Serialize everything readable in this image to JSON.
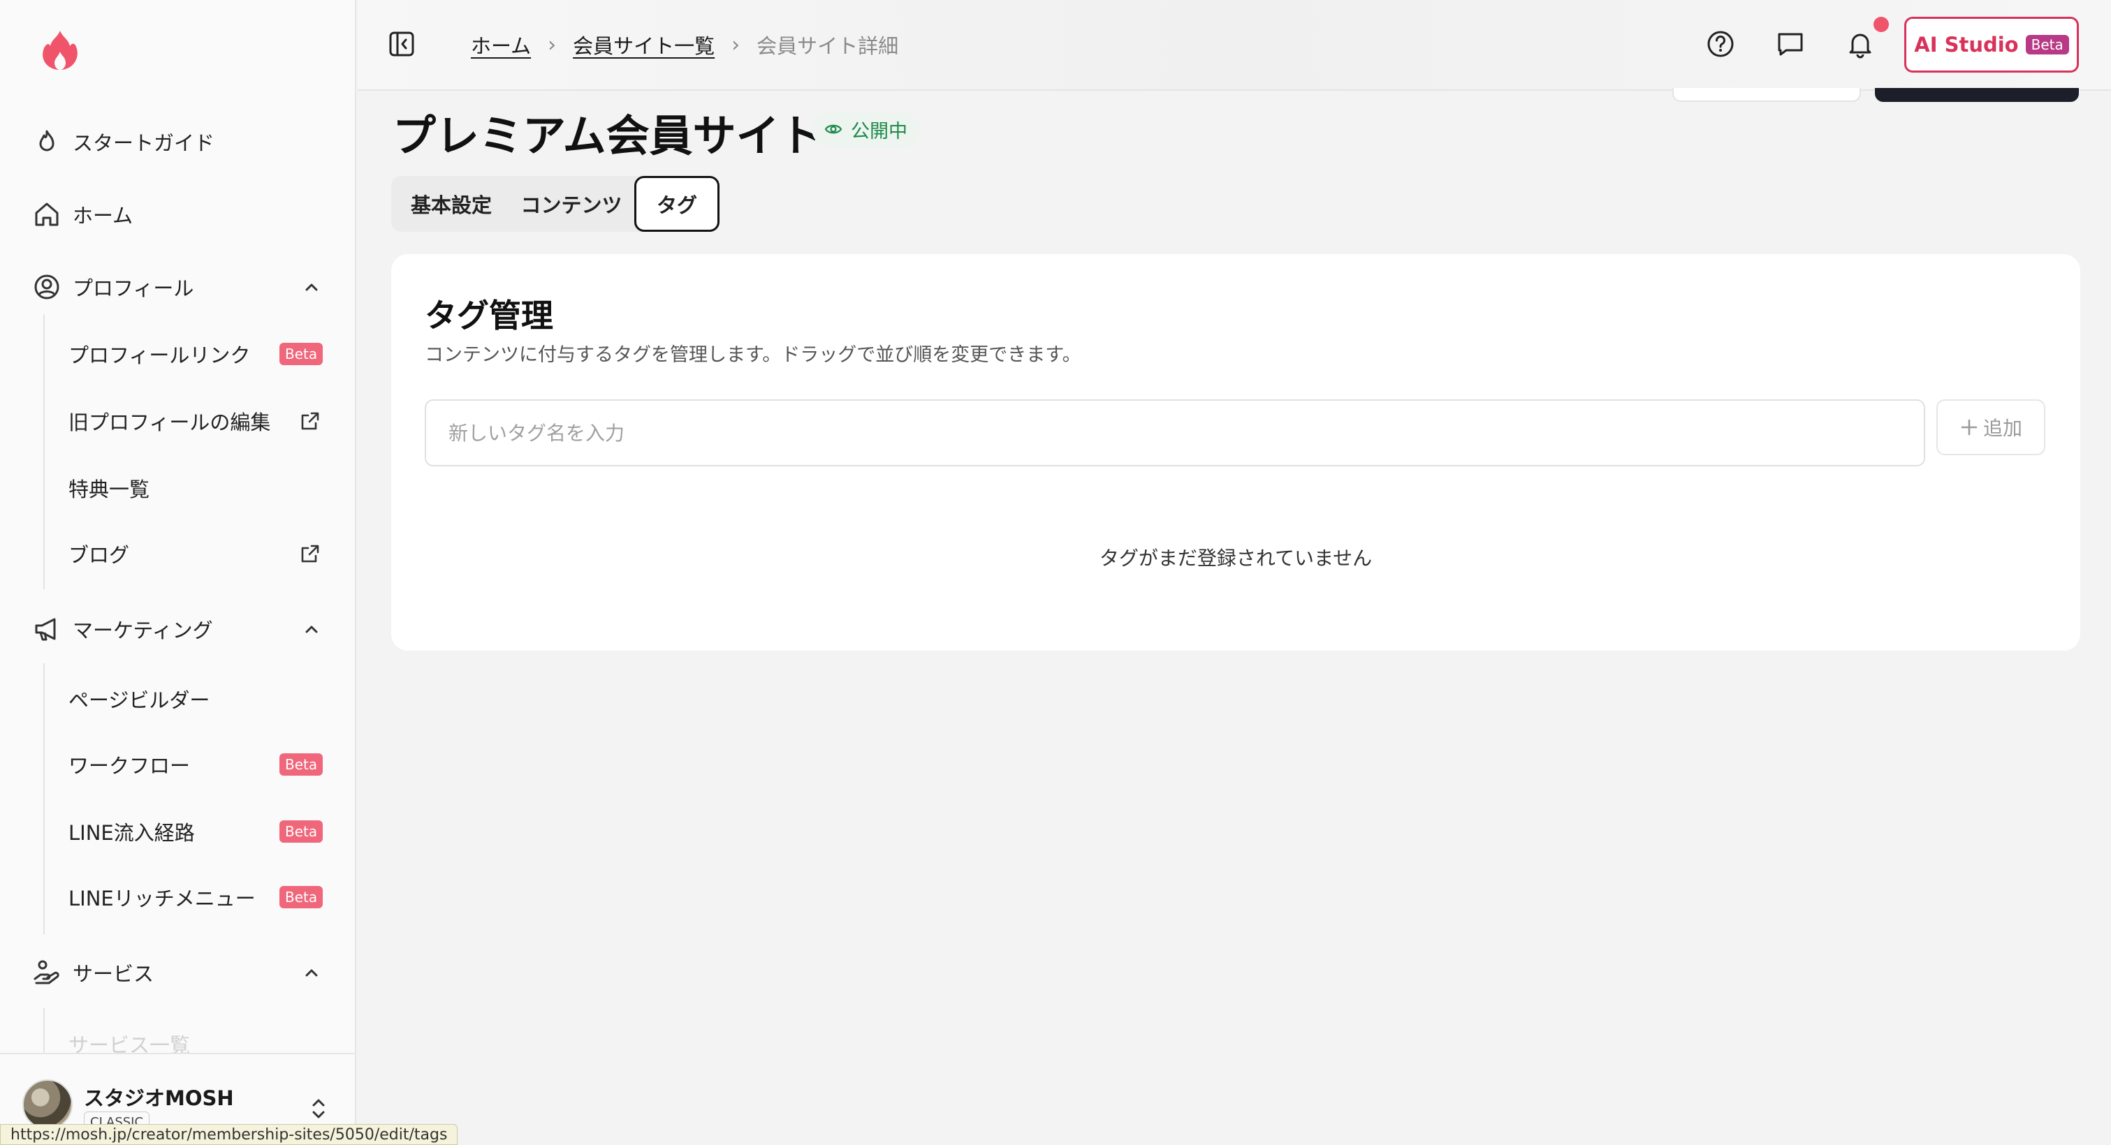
{
  "sidebar": {
    "logo_icon": "flame-logo-icon",
    "items": [
      {
        "label": "スタートガイド",
        "icon": "flame-outline-icon"
      },
      {
        "label": "ホーム",
        "icon": "home-icon"
      },
      {
        "label": "プロフィール",
        "icon": "user-circle-icon",
        "expanded": true,
        "children": [
          {
            "label": "プロフィールリンク",
            "badge": "Beta"
          },
          {
            "label": "旧プロフィールの編集",
            "external": true
          },
          {
            "label": "特典一覧"
          },
          {
            "label": "ブログ",
            "external": true
          }
        ]
      },
      {
        "label": "マーケティング",
        "icon": "megaphone-icon",
        "expanded": true,
        "children": [
          {
            "label": "ページビルダー"
          },
          {
            "label": "ワークフロー",
            "badge": "Beta"
          },
          {
            "label": "LINE流入経路",
            "badge": "Beta"
          },
          {
            "label": "LINEリッチメニュー",
            "badge": "Beta"
          }
        ]
      },
      {
        "label": "サービス",
        "icon": "hand-service-icon",
        "expanded": true,
        "children": [
          {
            "label": "サービス一覧"
          }
        ]
      }
    ],
    "account": {
      "name": "スタジオMOSH",
      "plan": "CLASSIC"
    }
  },
  "header": {
    "breadcrumb": [
      "ホーム",
      "会員サイト一覧",
      "会員サイト詳細"
    ],
    "icons": [
      "help-circle-icon",
      "chat-icon",
      "bell-icon"
    ],
    "has_notification": true,
    "ai_studio": {
      "label": "AI Studio",
      "badge": "Beta"
    }
  },
  "page": {
    "title": "プレミアム会員サイト",
    "status": "公開中",
    "tabs": [
      "基本設定",
      "コンテンツ",
      "タグ"
    ],
    "active_tab": "タグ"
  },
  "tags": {
    "heading": "タグ管理",
    "description": "コンテンツに付与するタグを管理します。ドラッグで並び順を変更できます。",
    "input_placeholder": "新しいタグ名を入力",
    "add_label": "追加",
    "empty_message": "タグがまだ登録されていません"
  },
  "browser_status_url": "https://mosh.jp/creator/membership-sites/5050/edit/tags",
  "colors": {
    "accent": "#d9325a",
    "badge": "#f0667b",
    "status_green": "#1e8a4c",
    "notification": "#f0546a"
  }
}
